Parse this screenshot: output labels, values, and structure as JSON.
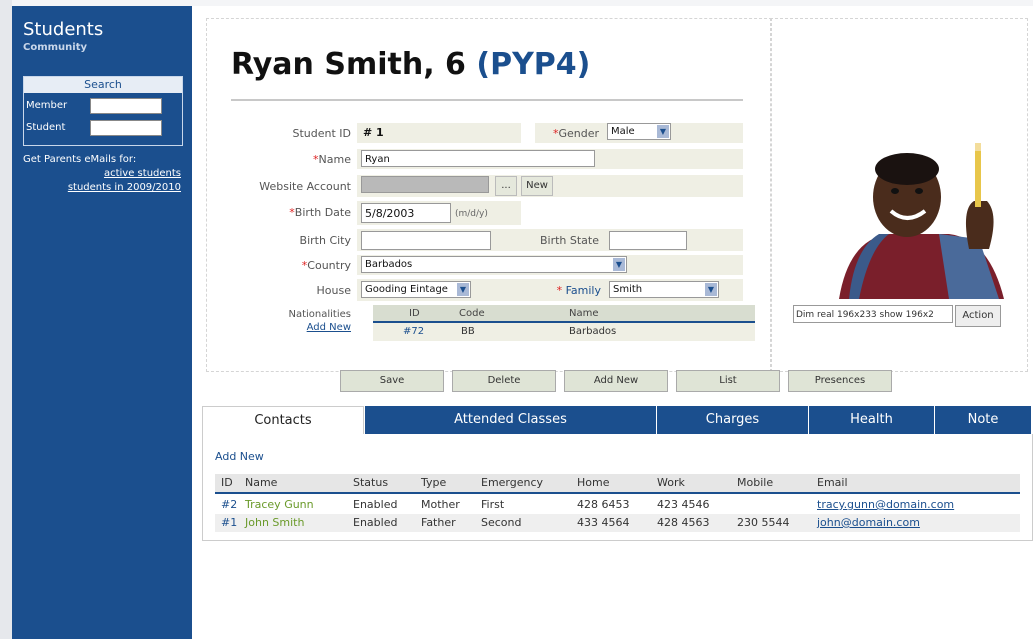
{
  "sidebar": {
    "title": "Students",
    "subtitle": "Community",
    "search": {
      "header": "Search",
      "member_label": "Member",
      "student_label": "Student"
    },
    "parents_text": "Get Parents eMails for:",
    "link_active": "active students",
    "link_year": "students in 2009/2010"
  },
  "student": {
    "name": "Ryan Smith, 6",
    "grade": "(PYP4)"
  },
  "form": {
    "student_id_label": "Student ID",
    "student_id": "# 1",
    "gender_label": "Gender",
    "gender_value": "Male",
    "name_label": "Name",
    "name_value": "Ryan",
    "website_label": "Website Account",
    "website_browse": "...",
    "website_new": "New",
    "birthdate_label": "Birth Date",
    "birthdate_value": "5/8/2003",
    "birthdate_hint": "(m/d/y)",
    "birthcity_label": "Birth City",
    "birthstate_label": "Birth State",
    "country_label": "Country",
    "country_value": "Barbados",
    "house_label": "House",
    "house_value": "Gooding Eintage",
    "family_label": "Family",
    "family_value": "Smith",
    "nationalities_label": "Nationalities",
    "add_new": "Add New",
    "nat_headers": [
      "ID",
      "Code",
      "Name"
    ],
    "nat_rows": [
      {
        "id": "#72",
        "code": "BB",
        "name": "Barbados"
      }
    ]
  },
  "photo": {
    "info": "Dim real 196x233 show 196x2",
    "action": "Action"
  },
  "actions": [
    "Save",
    "Delete",
    "Add New",
    "List",
    "Presences"
  ],
  "tabs": [
    "Contacts",
    "Attended Classes",
    "Charges",
    "Health",
    "Note"
  ],
  "contacts": {
    "add_new": "Add New",
    "headers": [
      "ID",
      "Name",
      "Status",
      "Type",
      "Emergency",
      "Home",
      "Work",
      "Mobile",
      "Email"
    ],
    "rows": [
      {
        "id": "#2",
        "name": "Tracey Gunn",
        "status": "Enabled",
        "type": "Mother",
        "emergency": "First",
        "home": "428 6453",
        "work": "423 4546",
        "mobile": "",
        "email": "tracy.gunn@domain.com"
      },
      {
        "id": "#1",
        "name": "John Smith",
        "status": "Enabled",
        "type": "Father",
        "emergency": "Second",
        "home": "433 4564",
        "work": "428 4563",
        "mobile": "230 5544",
        "email": "john@domain.com"
      }
    ]
  },
  "colors": {
    "brand": "#1b4f8e",
    "band": "#efefe4",
    "required": "#dd2222"
  }
}
